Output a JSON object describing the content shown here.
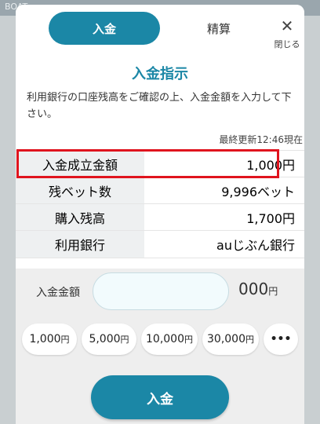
{
  "tabs": {
    "deposit": "入金",
    "settle": "精算"
  },
  "close": {
    "label": "閉じる"
  },
  "title": "入金指示",
  "description": "利用銀行の口座残高をご確認の上、入金金額を入力して下さい。",
  "updated": "最終更新12:46現在",
  "info_rows": [
    {
      "label": "入金成立金額",
      "value": "1,000円"
    },
    {
      "label": "残ベット数",
      "value": "9,996ベット"
    },
    {
      "label": "購入残高",
      "value": "1,700円"
    },
    {
      "label": "利用銀行",
      "value": "auじぶん銀行"
    }
  ],
  "amount": {
    "label": "入金金額",
    "value": "",
    "suffix_num": "000",
    "suffix_unit": "円"
  },
  "quick_amounts": [
    {
      "num": "1,000",
      "unit": "円"
    },
    {
      "num": "5,000",
      "unit": "円"
    },
    {
      "num": "10,000",
      "unit": "円"
    },
    {
      "num": "30,000",
      "unit": "円"
    }
  ],
  "more": "•••",
  "submit": "入金",
  "colors": {
    "accent": "#1b87a6",
    "highlight": "#e0141e"
  },
  "bg_labels": {
    "brand": "BOAT"
  }
}
